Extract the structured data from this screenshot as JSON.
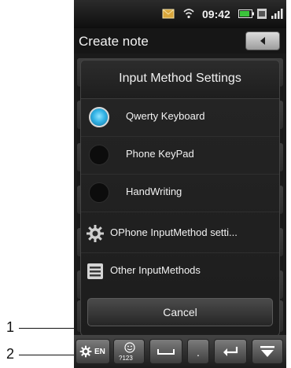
{
  "status_bar": {
    "time": "09:42",
    "icons": [
      "mail-icon",
      "wifi-icon",
      "battery-icon",
      "sim-icon",
      "signal-icon"
    ]
  },
  "title_bar": {
    "title": "Create note",
    "back_icon": "back-arrow-icon"
  },
  "dialog": {
    "title": "Input Method Settings",
    "options": [
      {
        "label": "Qwerty Keyboard",
        "selected": true
      },
      {
        "label": "Phone KeyPad",
        "selected": false
      },
      {
        "label": "HandWriting",
        "selected": false
      }
    ],
    "links": [
      {
        "label": "OPhone InputMethod setti...",
        "icon": "gear-icon"
      },
      {
        "label": "Other InputMethods",
        "icon": "list-icon"
      }
    ],
    "cancel_label": "Cancel"
  },
  "keyboard_bar": {
    "language_label": "EN",
    "symbols_label": "?123",
    "keys": [
      "settings-gear-icon",
      "smiley-icon",
      "space-icon",
      "period-key",
      "enter-icon",
      "hide-keyboard-icon"
    ],
    "dot_label": "."
  },
  "callouts": [
    "1",
    "2"
  ],
  "colors": {
    "accent_radio": "#33b3e6",
    "dialog_bg": "#222222"
  }
}
